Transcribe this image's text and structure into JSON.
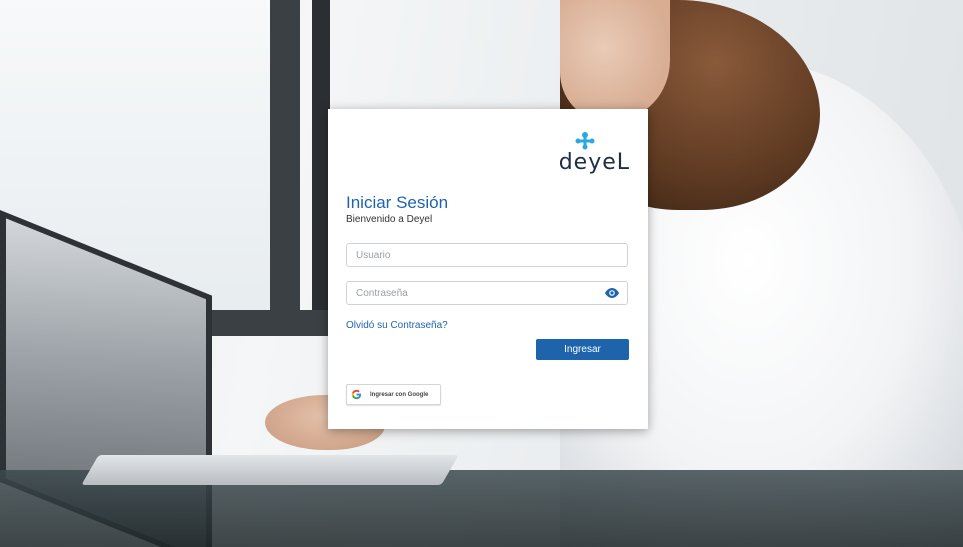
{
  "brand": {
    "logo_text": "deyeL",
    "logo_color": "#1f2d45",
    "logo_mark_color": "#2aa8e0"
  },
  "login": {
    "title": "Iniciar Sesión",
    "subtitle": "Bienvenido a Deyel",
    "username_placeholder": "Usuario",
    "username_value": "",
    "password_placeholder": "Contraseña",
    "password_value": "",
    "show_password_icon": "eye-icon",
    "forgot_password_label": "Olvidó su Contraseña?",
    "submit_label": "Ingresar",
    "google_label": "Ingresar con Google",
    "google_icon": "google-icon"
  },
  "colors": {
    "accent": "#1d64ad",
    "card_bg": "#ffffff",
    "eye_icon": "#1d64ad"
  }
}
